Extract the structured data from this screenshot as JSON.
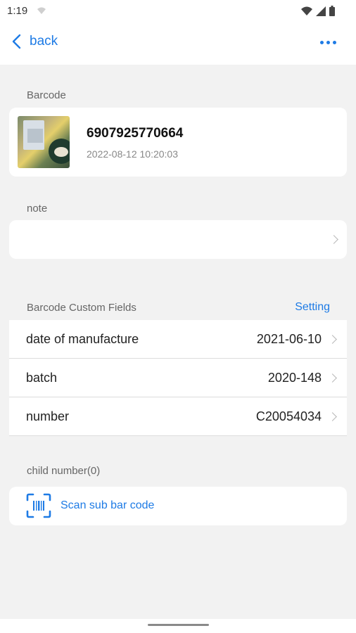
{
  "status": {
    "time": "1:19"
  },
  "topbar": {
    "back_label": "back"
  },
  "barcode_section": {
    "title": "Barcode",
    "code": "6907925770664",
    "timestamp": "2022-08-12 10:20:03"
  },
  "note_section": {
    "title": "note"
  },
  "custom_fields": {
    "title": "Barcode Custom Fields",
    "setting_label": "Setting",
    "rows": [
      {
        "label": "date of manufacture",
        "value": "2021-06-10"
      },
      {
        "label": "batch",
        "value": "2020-148"
      },
      {
        "label": "number",
        "value": "C20054034"
      }
    ]
  },
  "child_section": {
    "title": "child number(0)",
    "scan_label": "Scan sub bar code"
  },
  "colors": {
    "accent": "#1e7be5",
    "background": "#f2f2f2",
    "card": "#ffffff"
  }
}
